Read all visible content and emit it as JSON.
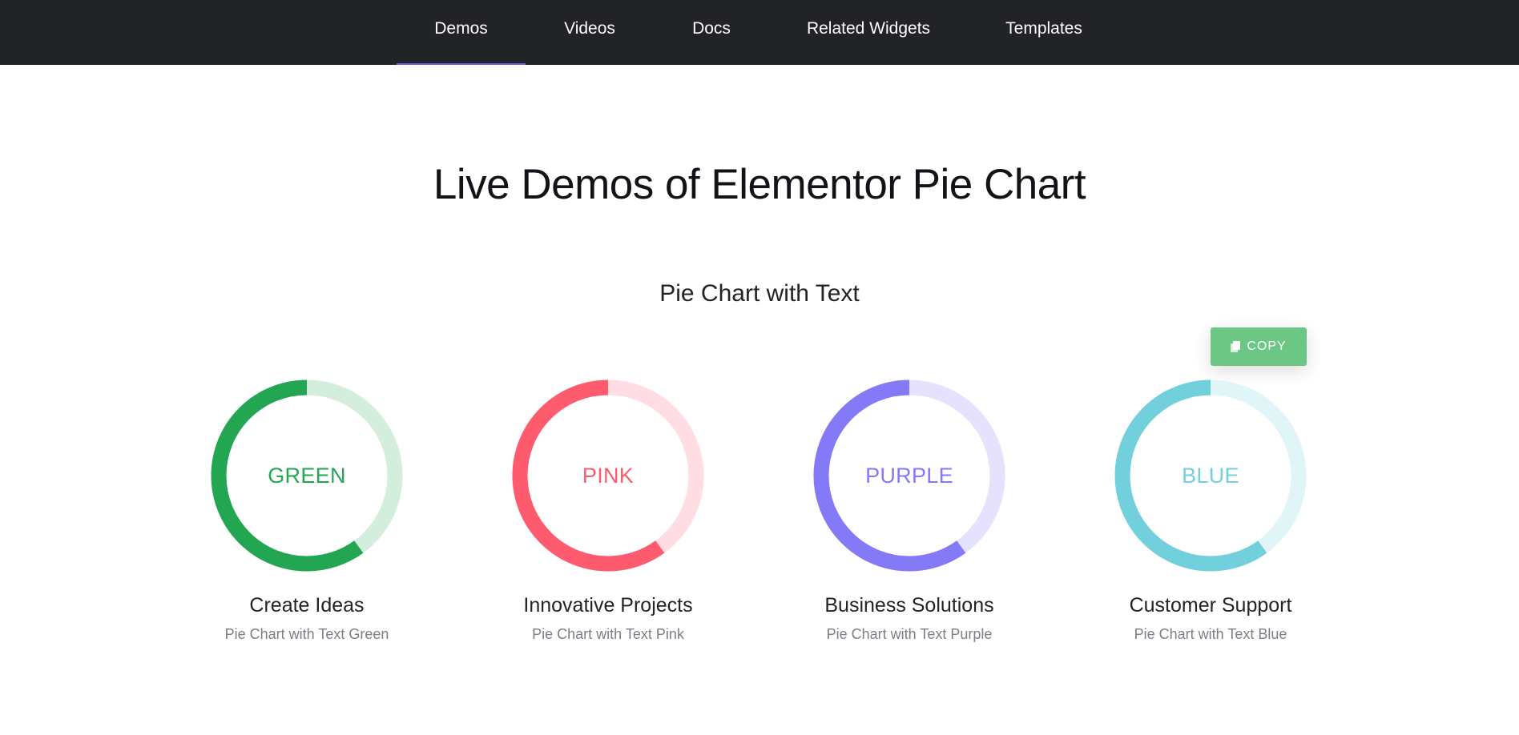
{
  "nav": {
    "items": [
      {
        "label": "Demos",
        "active": true
      },
      {
        "label": "Videos",
        "active": false
      },
      {
        "label": "Docs",
        "active": false
      },
      {
        "label": "Related Widgets",
        "active": false
      },
      {
        "label": "Templates",
        "active": false
      }
    ],
    "accent": "#6d5ff5",
    "background": "#212327"
  },
  "page": {
    "title": "Live Demos of Elementor Pie Chart",
    "section_title": "Pie Chart with Text"
  },
  "copy_button": {
    "label": "COPY",
    "icon": "copy-icon",
    "color": "#6cc785"
  },
  "charts": [
    {
      "center_text": "GREEN",
      "title": "Create Ideas",
      "subtitle": "Pie Chart with Text Green",
      "percent": 60,
      "color": "#22a652",
      "track": "#d4eedd"
    },
    {
      "center_text": "PINK",
      "title": "Innovative Projects",
      "subtitle": "Pie Chart with Text Pink",
      "percent": 60,
      "color": "#ff5b6e",
      "track": "#ffdde2"
    },
    {
      "center_text": "PURPLE",
      "title": "Business Solutions",
      "subtitle": "Pie Chart with Text Purple",
      "percent": 60,
      "color": "#8479f7",
      "track": "#e5e2fd"
    },
    {
      "center_text": "BLUE",
      "title": "Customer Support",
      "subtitle": "Pie Chart with Text Blue",
      "percent": 60,
      "color": "#72d0dc",
      "track": "#e0f5f7"
    }
  ]
}
